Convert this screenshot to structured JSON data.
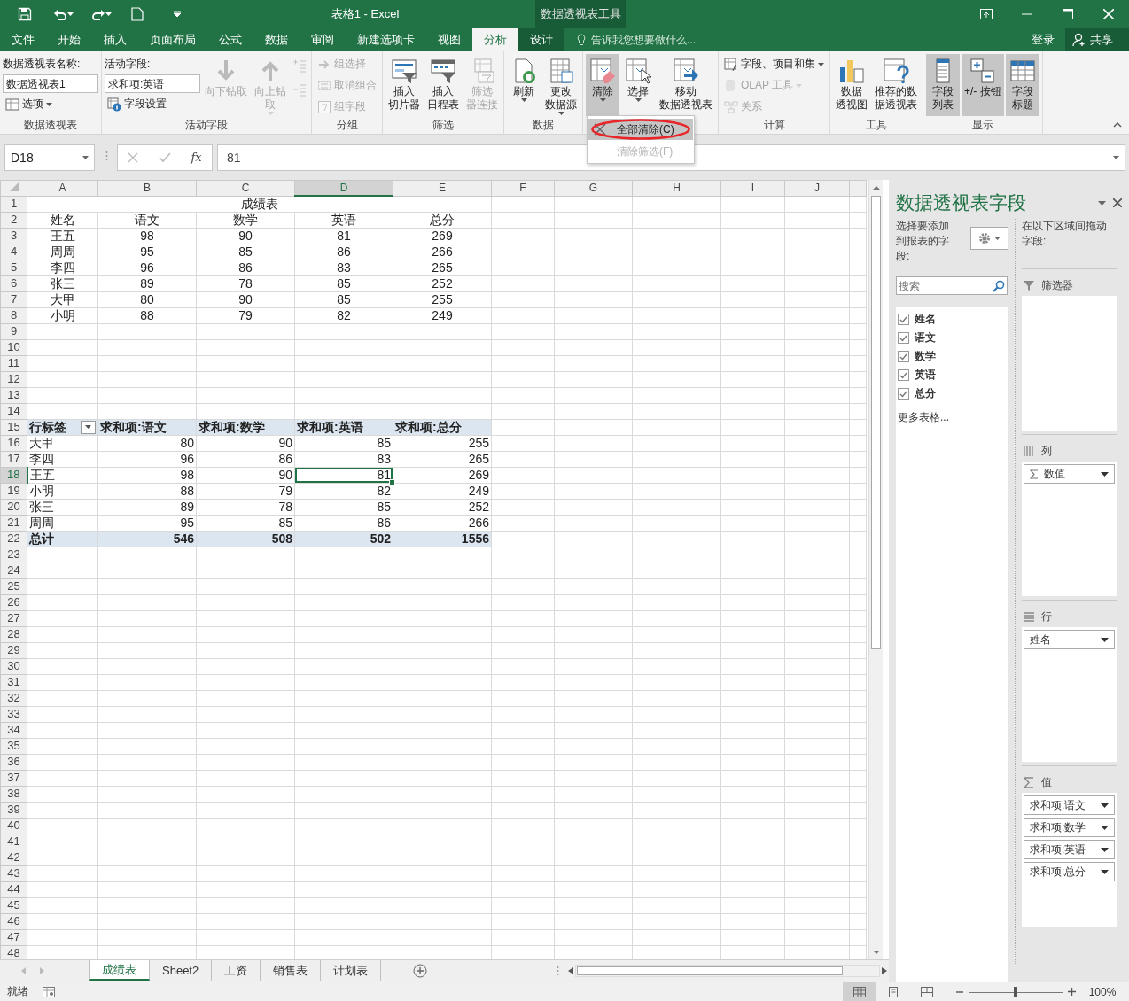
{
  "title_bar": {
    "title": "表格1 - Excel",
    "context_label": "数据透视表工具"
  },
  "tabs": [
    {
      "label": "文件",
      "selected": false,
      "context": false
    },
    {
      "label": "开始",
      "selected": false,
      "context": false
    },
    {
      "label": "插入",
      "selected": false,
      "context": false
    },
    {
      "label": "页面布局",
      "selected": false,
      "context": false
    },
    {
      "label": "公式",
      "selected": false,
      "context": false
    },
    {
      "label": "数据",
      "selected": false,
      "context": false
    },
    {
      "label": "审阅",
      "selected": false,
      "context": false
    },
    {
      "label": "新建选项卡",
      "selected": false,
      "context": false
    },
    {
      "label": "视图",
      "selected": false,
      "context": false
    },
    {
      "label": "分析",
      "selected": true,
      "context": true
    },
    {
      "label": "设计",
      "selected": false,
      "context": true
    }
  ],
  "tell_me": {
    "placeholder": "告诉我您想要做什么..."
  },
  "account": {
    "sign_in": "登录",
    "share": "共享"
  },
  "ribbon": {
    "groups": [
      {
        "label": "数据透视表",
        "columns": [
          [
            {
              "kind": "field",
              "label": "数据透视表名称:",
              "value": "数据透视表1"
            },
            {
              "kind": "small",
              "label": "选项",
              "caret": true,
              "disabled": false
            }
          ]
        ]
      },
      {
        "label": "活动字段",
        "columns": [
          [
            {
              "kind": "field",
              "label": "活动字段:",
              "value": "求和项:英语"
            },
            {
              "kind": "small",
              "label": "字段设置",
              "disabled": false
            }
          ],
          [
            {
              "kind": "large",
              "lines": [
                "向下钻取"
              ],
              "disabled": true
            }
          ],
          [
            {
              "kind": "large",
              "lines": [
                "向上钻",
                "取"
              ],
              "caret": true,
              "disabled": true
            }
          ],
          [
            {
              "kind": "icon",
              "disabled": true
            },
            {
              "kind": "icon",
              "disabled": true
            }
          ]
        ]
      },
      {
        "label": "分组",
        "columns": [
          [
            {
              "kind": "small",
              "label": "组选择",
              "disabled": true
            },
            {
              "kind": "small",
              "label": "取消组合",
              "disabled": true
            },
            {
              "kind": "small",
              "label": "组字段",
              "disabled": true
            }
          ]
        ]
      },
      {
        "label": "筛选",
        "columns": [
          [
            {
              "kind": "large",
              "lines": [
                "插入",
                "切片器"
              ],
              "disabled": false
            }
          ],
          [
            {
              "kind": "large",
              "lines": [
                "插入",
                "日程表"
              ],
              "disabled": false
            }
          ],
          [
            {
              "kind": "large",
              "lines": [
                "筛选",
                "器连接"
              ],
              "disabled": true
            }
          ]
        ]
      },
      {
        "label": "数据",
        "columns": [
          [
            {
              "kind": "large",
              "lines": [
                "刷新"
              ],
              "caret": true,
              "disabled": false
            }
          ],
          [
            {
              "kind": "large",
              "lines": [
                "更改",
                "数据源"
              ],
              "caret": true,
              "disabled": false
            }
          ]
        ]
      },
      {
        "columns": [
          [
            {
              "kind": "large",
              "lines": [
                "清除"
              ],
              "caret": true,
              "disabled": false,
              "expanded": true
            }
          ],
          [
            {
              "kind": "large",
              "lines": [
                "选择"
              ],
              "caret": true,
              "disabled": false,
              "expanded": false
            }
          ],
          [
            {
              "kind": "large",
              "lines": [
                "移动",
                "数据透视表"
              ],
              "disabled": false,
              "expanded": false
            }
          ]
        ]
      },
      {
        "label": "计算",
        "columns": [
          [
            {
              "kind": "small",
              "label": "字段、项目和集",
              "caret": true,
              "disabled": false
            },
            {
              "kind": "small",
              "label": "OLAP 工具",
              "caret": true,
              "disabled": true
            },
            {
              "kind": "small",
              "label": "关系",
              "disabled": true
            }
          ]
        ]
      },
      {
        "label": "工具",
        "columns": [
          [
            {
              "kind": "large",
              "lines": [
                "数据",
                "透视图"
              ],
              "disabled": false
            }
          ],
          [
            {
              "kind": "large",
              "lines": [
                "推荐的数",
                "据透视表"
              ],
              "disabled": false
            }
          ]
        ]
      },
      {
        "label": "显示",
        "columns": [
          [
            {
              "kind": "large",
              "lines": [
                "字段",
                "列表"
              ],
              "disabled": false,
              "selected": true
            }
          ],
          [
            {
              "kind": "large",
              "lines": [
                "+/- 按钮"
              ],
              "disabled": false,
              "selected": true
            }
          ],
          [
            {
              "kind": "large",
              "lines": [
                "字段",
                "标题"
              ],
              "disabled": false,
              "selected": true
            }
          ]
        ]
      }
    ]
  },
  "menu": {
    "items": [
      {
        "label": "全部清除(C)",
        "highlighted": true,
        "disabled": false,
        "circled": true
      },
      {
        "label": "清除筛选(F)",
        "highlighted": false,
        "disabled": true,
        "circled": false
      }
    ]
  },
  "formula_bar": {
    "name_box": "D18",
    "function_label": "fx",
    "formula": "81"
  },
  "sheet": {
    "columns": [
      {
        "label": "A",
        "selected": false
      },
      {
        "label": "B",
        "selected": false
      },
      {
        "label": "C",
        "selected": false
      },
      {
        "label": "D",
        "selected": true
      },
      {
        "label": "E",
        "selected": false
      },
      {
        "label": "F",
        "selected": false
      },
      {
        "label": "G",
        "selected": false
      },
      {
        "label": "H",
        "selected": false
      },
      {
        "label": "I",
        "selected": false
      },
      {
        "label": "J",
        "selected": false
      }
    ],
    "rows": [
      {
        "label": "1",
        "selected": false
      },
      {
        "label": "2",
        "selected": false
      },
      {
        "label": "3",
        "selected": false
      },
      {
        "label": "4",
        "selected": false
      },
      {
        "label": "5",
        "selected": false
      },
      {
        "label": "6",
        "selected": false
      },
      {
        "label": "7",
        "selected": false
      },
      {
        "label": "8",
        "selected": false
      },
      {
        "label": "9",
        "selected": false
      },
      {
        "label": "10",
        "selected": false
      },
      {
        "label": "11",
        "selected": false
      },
      {
        "label": "12",
        "selected": false
      },
      {
        "label": "13",
        "selected": false
      },
      {
        "label": "14",
        "selected": false
      },
      {
        "label": "15",
        "selected": false
      },
      {
        "label": "16",
        "selected": false
      },
      {
        "label": "17",
        "selected": false
      },
      {
        "label": "18",
        "selected": true
      },
      {
        "label": "19",
        "selected": false
      },
      {
        "label": "20",
        "selected": false
      },
      {
        "label": "21",
        "selected": false
      },
      {
        "label": "22",
        "selected": false
      },
      {
        "label": "23",
        "selected": false
      },
      {
        "label": "24",
        "selected": false
      },
      {
        "label": "25",
        "selected": false
      },
      {
        "label": "26",
        "selected": false
      },
      {
        "label": "27",
        "selected": false
      },
      {
        "label": "28",
        "selected": false
      },
      {
        "label": "29",
        "selected": false
      },
      {
        "label": "30",
        "selected": false
      },
      {
        "label": "31",
        "selected": false
      },
      {
        "label": "32",
        "selected": false
      },
      {
        "label": "33",
        "selected": false
      },
      {
        "label": "34",
        "selected": false
      },
      {
        "label": "35",
        "selected": false
      },
      {
        "label": "36",
        "selected": false
      },
      {
        "label": "37",
        "selected": false
      },
      {
        "label": "38",
        "selected": false
      },
      {
        "label": "39",
        "selected": false
      },
      {
        "label": "40",
        "selected": false
      },
      {
        "label": "41",
        "selected": false
      },
      {
        "label": "42",
        "selected": false
      },
      {
        "label": "43",
        "selected": false
      },
      {
        "label": "44",
        "selected": false
      },
      {
        "label": "45",
        "selected": false
      },
      {
        "label": "46",
        "selected": false
      },
      {
        "label": "47",
        "selected": false
      },
      {
        "label": "48",
        "selected": false
      }
    ],
    "title": "成绩表",
    "source_table": {
      "header": [
        "姓名",
        "语文",
        "数学",
        "英语",
        "总分"
      ],
      "rows": [
        [
          "王五",
          "98",
          "90",
          "81",
          "269"
        ],
        [
          "周周",
          "95",
          "85",
          "86",
          "266"
        ],
        [
          "李四",
          "96",
          "86",
          "83",
          "265"
        ],
        [
          "张三",
          "89",
          "78",
          "85",
          "252"
        ],
        [
          "大甲",
          "80",
          "90",
          "85",
          "255"
        ],
        [
          "小明",
          "88",
          "79",
          "82",
          "249"
        ]
      ]
    },
    "pivot_table": {
      "header": [
        "行标签",
        "求和项:语文",
        "求和项:数学",
        "求和项:英语",
        "求和项:总分"
      ],
      "rows": [
        {
          "label": "大甲",
          "values": [
            {
              "text": "80",
              "selected": false
            },
            {
              "text": "90",
              "selected": false
            },
            {
              "text": "85",
              "selected": false
            },
            {
              "text": "255",
              "selected": false
            }
          ]
        },
        {
          "label": "李四",
          "values": [
            {
              "text": "96",
              "selected": false
            },
            {
              "text": "86",
              "selected": false
            },
            {
              "text": "83",
              "selected": false
            },
            {
              "text": "265",
              "selected": false
            }
          ]
        },
        {
          "label": "王五",
          "values": [
            {
              "text": "98",
              "selected": false
            },
            {
              "text": "90",
              "selected": false
            },
            {
              "text": "81",
              "selected": true
            },
            {
              "text": "269",
              "selected": false
            }
          ]
        },
        {
          "label": "小明",
          "values": [
            {
              "text": "88",
              "selected": false
            },
            {
              "text": "79",
              "selected": false
            },
            {
              "text": "82",
              "selected": false
            },
            {
              "text": "249",
              "selected": false
            }
          ]
        },
        {
          "label": "张三",
          "values": [
            {
              "text": "89",
              "selected": false
            },
            {
              "text": "78",
              "selected": false
            },
            {
              "text": "85",
              "selected": false
            },
            {
              "text": "252",
              "selected": false
            }
          ]
        },
        {
          "label": "周周",
          "values": [
            {
              "text": "95",
              "selected": false
            },
            {
              "text": "85",
              "selected": false
            },
            {
              "text": "86",
              "selected": false
            },
            {
              "text": "266",
              "selected": false
            }
          ]
        }
      ],
      "total": {
        "label": "总计",
        "values": [
          "546",
          "508",
          "502",
          "1556"
        ]
      }
    }
  },
  "sheet_tabs": [
    {
      "label": "成绩表",
      "selected": true
    },
    {
      "label": "Sheet2",
      "selected": false
    },
    {
      "label": "工资",
      "selected": false
    },
    {
      "label": "销售表",
      "selected": false
    },
    {
      "label": "计划表",
      "selected": false
    }
  ],
  "field_pane": {
    "title": "数据透视表字段",
    "instruction": "选择要添加到报表的字段:",
    "search": {
      "placeholder": "搜索"
    },
    "fields": [
      {
        "label": "姓名",
        "checked": true
      },
      {
        "label": "语文",
        "checked": true
      },
      {
        "label": "数学",
        "checked": true
      },
      {
        "label": "英语",
        "checked": true
      },
      {
        "label": "总分",
        "checked": true
      }
    ],
    "more_tables": "更多表格...",
    "areas_hint": "在以下区域间拖动字段:",
    "areas": [
      {
        "kind": "filters",
        "label": "筛选器"
      },
      {
        "kind": "columns",
        "label": "列",
        "items": [
          {
            "kind": "values_field",
            "label": "数值"
          }
        ]
      },
      {
        "kind": "rows",
        "label": "行",
        "items": [
          {
            "kind": "field",
            "label": "姓名"
          }
        ]
      },
      {
        "kind": "values",
        "label": "值",
        "items": [
          {
            "kind": "field",
            "label": "求和项:语文"
          },
          {
            "kind": "field",
            "label": "求和项:数学"
          },
          {
            "kind": "field",
            "label": "求和项:英语"
          },
          {
            "kind": "field",
            "label": "求和项:总分"
          }
        ]
      }
    ]
  },
  "status_bar": {
    "status": "就绪",
    "views": [
      {
        "kind": "normal",
        "selected": true
      },
      {
        "kind": "page_layout",
        "selected": false
      },
      {
        "kind": "page_break",
        "selected": false
      }
    ],
    "zoom": {
      "level": 0.5,
      "reading": "100%"
    }
  }
}
